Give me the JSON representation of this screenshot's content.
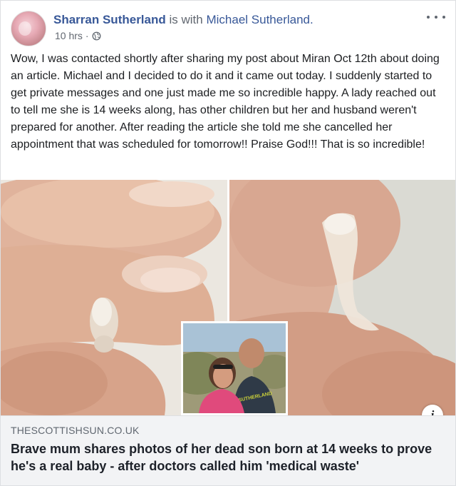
{
  "post": {
    "author": "Sharran Sutherland",
    "with_text": "is with",
    "tagged": "Michael Sutherland.",
    "time": "10 hrs",
    "separator": "·",
    "privacy_icon": "globe-icon",
    "menu_icon": "more-options-icon",
    "text": "Wow, I was contacted shortly after sharing my post about Miran Oct 12th about doing an article. Michael and I decided to do it and it came out today. I suddenly started to get private messages and one just made me so incredible happy. A lady reached out to tell me she is 14 weeks along, has other children but her and husband weren't prepared for another. After reading the article she told me she cancelled her appointment that was scheduled for tomorrow!! Praise God!!! That is so incredible!"
  },
  "photos": {
    "info_glyph": "i",
    "inset_shirt_text": "SUTHERLAND"
  },
  "link_preview": {
    "domain": "THESCOTTISHSUN.CO.UK",
    "headline": "Brave mum shares photos of her dead son born at 14 weeks to prove he's a real baby - after doctors called him 'medical waste'"
  },
  "colors": {
    "link": "#385898",
    "secondary_text": "#616770",
    "preview_bg": "#f2f3f5"
  }
}
